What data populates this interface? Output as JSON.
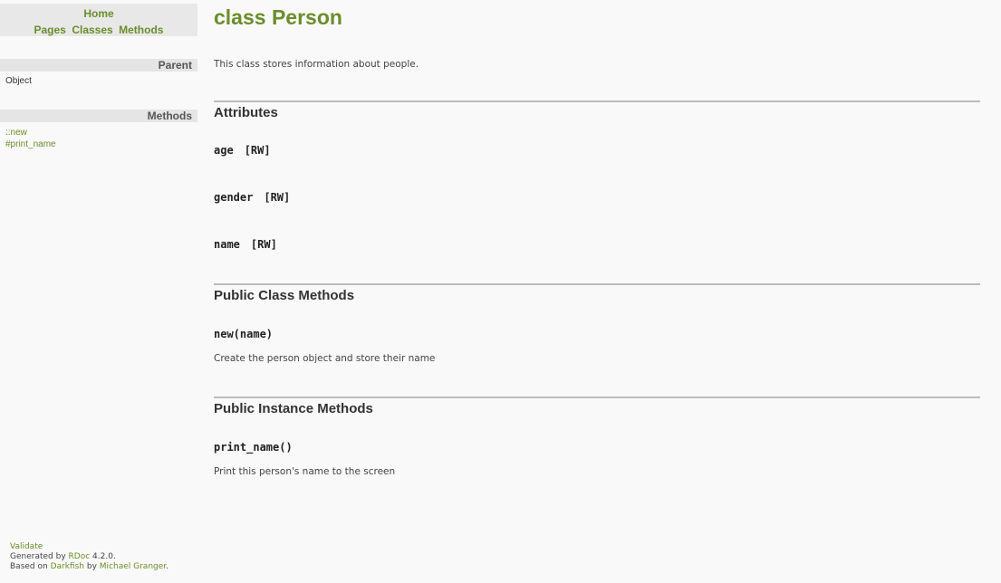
{
  "nav": {
    "home": "Home",
    "pages": "Pages",
    "classes": "Classes",
    "methods": "Methods"
  },
  "sidebar": {
    "parent_heading": "Parent",
    "parent_value": "Object",
    "methods_heading": "Methods",
    "methods": [
      "::new",
      "#print_name"
    ]
  },
  "footer": {
    "validate": "Validate",
    "generated_prefix": "Generated by",
    "rdoc": "RDoc",
    "version": "4.2.0.",
    "based_on": "Based on",
    "darkfish": "Darkfish",
    "by": "by",
    "author": "Michael Granger",
    "period": "."
  },
  "main": {
    "title": "class Person",
    "description": "This class stores information about people.",
    "attributes_heading": "Attributes",
    "attributes": [
      {
        "name": "age",
        "rw": "[RW]"
      },
      {
        "name": "gender",
        "rw": "[RW]"
      },
      {
        "name": "name",
        "rw": "[RW]"
      }
    ],
    "class_methods_heading": "Public Class Methods",
    "class_methods": [
      {
        "signature": "new(name)",
        "description": "Create the person object and store their name"
      }
    ],
    "instance_methods_heading": "Public Instance Methods",
    "instance_methods": [
      {
        "signature": "print_name()",
        "description": "Print this person's name to the screen"
      }
    ]
  },
  "colors": {
    "accent": "#6a8e2b",
    "background": "#f9f9f9",
    "sidebar_header": "#e5e5e5",
    "rule": "#bbbbbb"
  }
}
